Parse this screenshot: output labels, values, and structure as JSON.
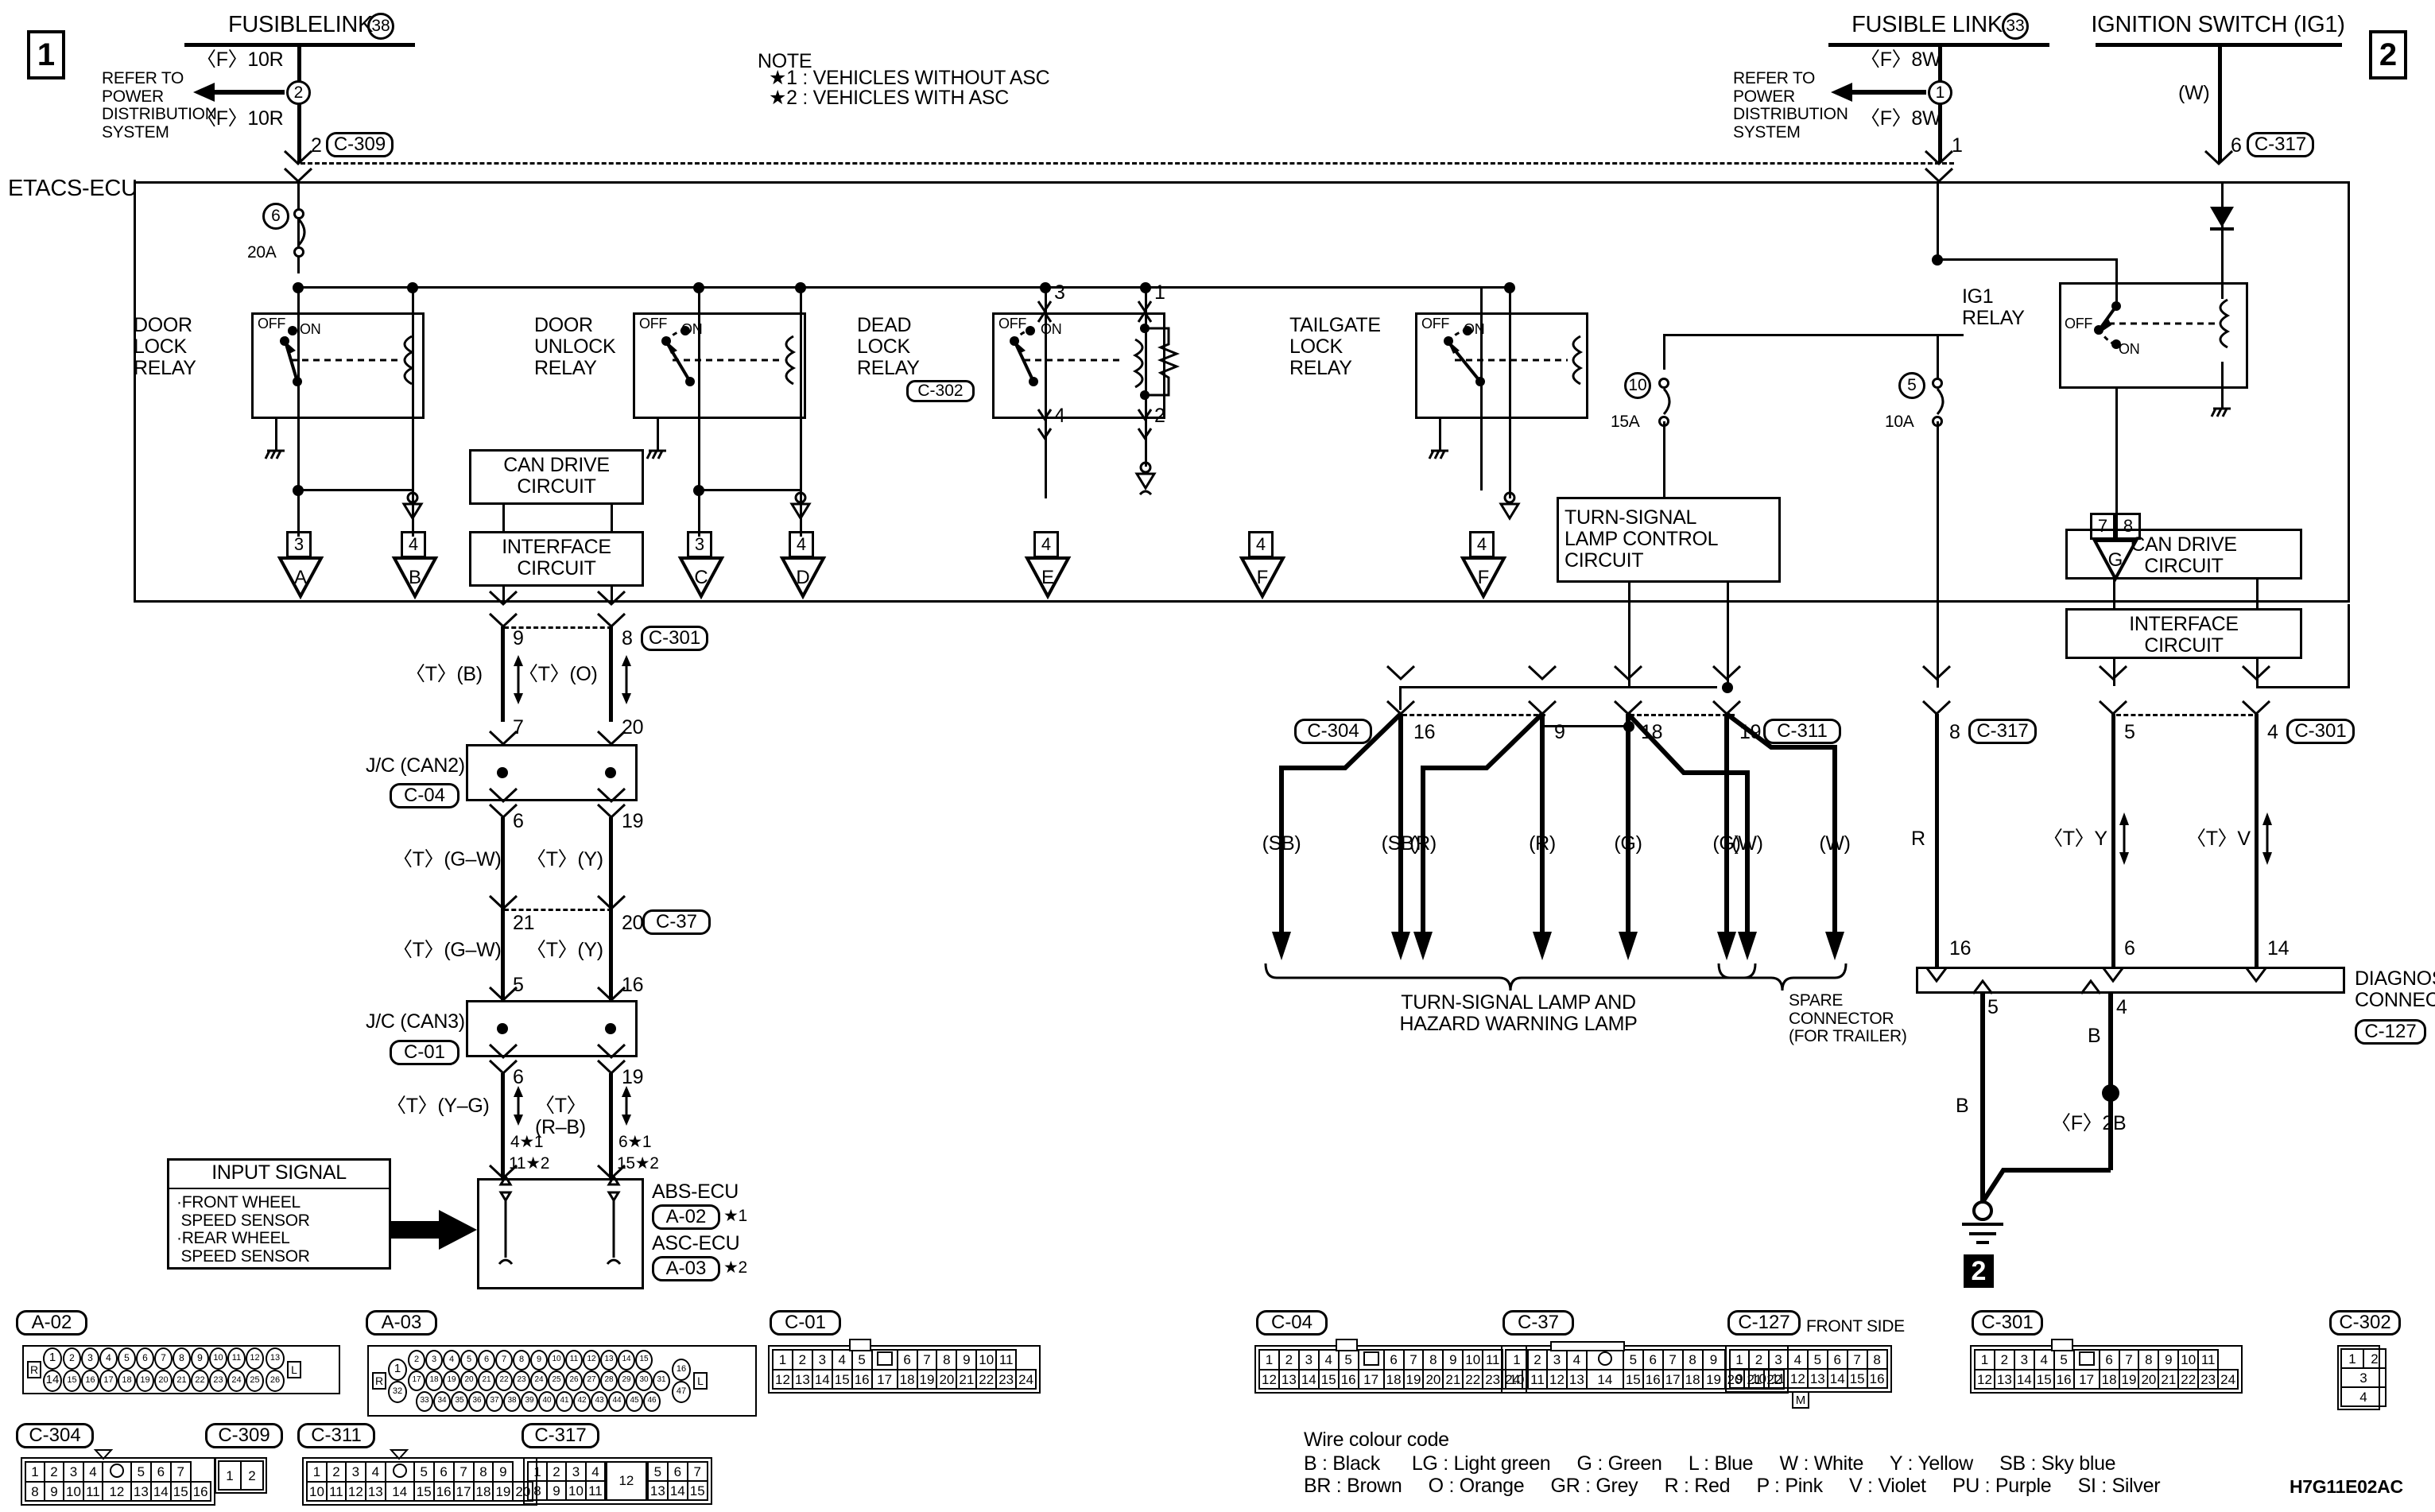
{
  "diagram": {
    "code": "H7G11E02AC",
    "page_left": "1",
    "page_right": "2",
    "page_ground_ref": "2"
  },
  "note": {
    "title": "NOTE",
    "lines": [
      "★1 : VEHICLES WITHOUT ASC",
      "★2 : VEHICLES WITH ASC"
    ]
  },
  "sources": {
    "fusible_link_38": {
      "title": "FUSIBLELINK",
      "circle": "38",
      "wire_top": "〈F〉10R",
      "wire_bottom": "〈F〉10R",
      "splice": "2",
      "pin": "2",
      "connector": "C-309"
    },
    "fusible_link_33": {
      "title": "FUSIBLE LINK",
      "circle": "33",
      "wire_top": "〈F〉8W",
      "wire_bottom": "〈F〉8W",
      "splice": "1",
      "pin": "1"
    },
    "ignition_switch": {
      "title": "IGNITION SWITCH (IG1)",
      "wire": "(W)",
      "pin": "6",
      "connector": "C-317"
    },
    "refer_note": "REFER TO\nPOWER\nDISTRIBUTION\nSYSTEM"
  },
  "ecu": {
    "label": "ETACS-ECU"
  },
  "fuses": [
    {
      "no": "6",
      "rating": "20A"
    },
    {
      "no": "10",
      "rating": "15A"
    },
    {
      "no": "5",
      "rating": "10A"
    }
  ],
  "relays": [
    {
      "name": "DOOR\nLOCK\nRELAY",
      "off": "OFF",
      "on": "ON"
    },
    {
      "name": "DOOR\nUNLOCK\nRELAY",
      "off": "OFF",
      "on": "ON"
    },
    {
      "name": "DEAD\nLOCK\nRELAY",
      "off": "OFF",
      "on": "ON",
      "connector": "C-302",
      "pins": [
        "3",
        "1",
        "4",
        "2"
      ]
    },
    {
      "name": "TAILGATE\nLOCK\nRELAY",
      "off": "OFF",
      "on": "ON"
    },
    {
      "name": "IG1\nRELAY",
      "off": "OFF",
      "on": "ON"
    }
  ],
  "blocks": {
    "can_drive_left": "CAN DRIVE\nCIRCUIT",
    "interface_left": "INTERFACE\nCIRCUIT",
    "turn_signal": "TURN-SIGNAL\nLAMP CONTROL\nCIRCUIT",
    "can_drive_right": "CAN DRIVE\nCIRCUIT",
    "interface_right": "INTERFACE\nCIRCUIT",
    "input_signal_title": "INPUT SIGNAL",
    "input_signal_items": "·FRONT WHEEL\n SPEED SENSOR\n·REAR WHEEL\n SPEED SENSOR"
  },
  "grounds": [
    {
      "num": "3",
      "letter": "A"
    },
    {
      "num": "4",
      "letter": "B"
    },
    {
      "num": "3",
      "letter": "C"
    },
    {
      "num": "4",
      "letter": "D"
    },
    {
      "num": "4",
      "letter": "E"
    },
    {
      "num": "4",
      "letter": "F"
    },
    {
      "num": "4",
      "letter": "F"
    },
    {
      "num": "7",
      "num2": "8",
      "letter": "G"
    }
  ],
  "can_bus": {
    "etacs_pins": [
      "9",
      "8"
    ],
    "etacs_connector": "C-301",
    "wires_1": [
      "〈T〉(B)",
      "〈T〉(O)"
    ],
    "jc_can2": {
      "label": "J/C (CAN2)",
      "connector": "C-04",
      "pins_top": [
        "7",
        "20"
      ],
      "pins_bot": [
        "6",
        "19"
      ]
    },
    "wires_2": [
      "〈T〉(G–W)",
      "〈T〉(Y)"
    ],
    "c37": {
      "connector": "C-37",
      "pins": [
        "21",
        "20"
      ]
    },
    "wires_3": [
      "〈T〉(G–W)",
      "〈T〉(Y)"
    ],
    "jc_can3": {
      "label": "J/C (CAN3)",
      "connector": "C-01",
      "pins_top": [
        "5",
        "16"
      ],
      "pins_bot": [
        "6",
        "19"
      ]
    },
    "wires_4": [
      "〈T〉(Y–G)",
      "〈T〉\n(R–B)"
    ],
    "abs_pins_left": [
      "4★1",
      "11★2"
    ],
    "abs_pins_right": [
      "6★1",
      "15★2"
    ],
    "abs_ecu": {
      "name1": "ABS-ECU",
      "conn1": "A-02",
      "star1": "★1",
      "name2": "ASC-ECU",
      "conn2": "A-03",
      "star2": "★2"
    }
  },
  "lamp_section": {
    "connectors": [
      {
        "name": "C-304",
        "pin": "16",
        "color": "(SB)"
      },
      {
        "pin": "",
        "color": "(SB)"
      },
      {
        "pin": "9",
        "color": "(R)"
      },
      {
        "pin": "",
        "color": "(R)"
      },
      {
        "pin": "18",
        "color": "(G)"
      },
      {
        "pin": "",
        "color": "(W)"
      },
      {
        "name": "C-311",
        "pin": "19",
        "color": "(G)"
      },
      {
        "pin": "",
        "color": "(W)"
      }
    ],
    "pins_row": [
      "16",
      "9",
      "18",
      "19"
    ],
    "label_main": "TURN-SIGNAL LAMP AND\nHAZARD WARNING LAMP",
    "label_spare": "SPARE\nCONNECTOR\n(FOR TRAILER)"
  },
  "diagnosis": {
    "title": "DIAGNOSIS\nCONNECTOR",
    "connector": "C-127",
    "top_pins": [
      {
        "pin": "8",
        "conn": "C-317",
        "wire": "R"
      },
      {
        "pin": "5",
        "conn": "",
        "wire": "〈T〉Y"
      },
      {
        "pin": "4",
        "conn": "C-301",
        "wire": "〈T〉V"
      }
    ],
    "bottom_pins": [
      "16",
      "6",
      "14"
    ],
    "out_pins": [
      "5",
      "4"
    ],
    "out_wires": [
      "B",
      "B"
    ],
    "fusible": "〈F〉2B"
  },
  "connector_tables": {
    "A-02": {
      "label": "A-02",
      "type": "oval",
      "left": "R",
      "right": "L",
      "first_col": [
        "1",
        "14"
      ],
      "row1": [
        "2",
        "3",
        "4",
        "5",
        "6",
        "7",
        "8",
        "9",
        "10",
        "11",
        "12"
      ],
      "row2": [
        "15",
        "16",
        "17",
        "18",
        "19",
        "20",
        "21",
        "22",
        "23",
        "24",
        "25"
      ],
      "last_col": [
        "13",
        "26"
      ]
    },
    "A-03": {
      "label": "A-03",
      "type": "oval",
      "left": "R",
      "right": "L",
      "first_col": [
        "1",
        "32"
      ],
      "row1": [
        "2",
        "3",
        "4",
        "5",
        "6",
        "7",
        "8",
        "9",
        "10",
        "11",
        "12",
        "13",
        "14",
        "15"
      ],
      "row2": [
        "17",
        "18",
        "19",
        "20",
        "21",
        "22",
        "23",
        "24",
        "25",
        "26",
        "27",
        "28",
        "29",
        "30",
        "31"
      ],
      "row3": [
        "33",
        "34",
        "35",
        "36",
        "37",
        "38",
        "39",
        "40",
        "41",
        "42",
        "43",
        "44",
        "45",
        "46"
      ],
      "last_col": [
        "16",
        "47"
      ]
    },
    "C-01": {
      "label": "C-01",
      "row1": [
        "1",
        "2",
        "3",
        "4",
        "5",
        "",
        "6",
        "7",
        "8",
        "9",
        "10",
        "11"
      ],
      "row2": [
        "12",
        "13",
        "14",
        "15",
        "16",
        "17",
        "18",
        "19",
        "20",
        "21",
        "22",
        "23",
        "24"
      ]
    },
    "C-04": {
      "label": "C-04",
      "row1": [
        "1",
        "2",
        "3",
        "4",
        "5",
        "",
        "6",
        "7",
        "8",
        "9",
        "10",
        "11"
      ],
      "row2": [
        "12",
        "13",
        "14",
        "15",
        "16",
        "17",
        "18",
        "19",
        "20",
        "21",
        "22",
        "23",
        "24"
      ]
    },
    "C-37": {
      "label": "C-37",
      "row1": [
        "1",
        "2",
        "3",
        "4",
        "",
        "",
        "5",
        "6",
        "7",
        "8",
        "9"
      ],
      "row2": [
        "10",
        "11",
        "12",
        "13",
        "14",
        "15",
        "16",
        "17",
        "18",
        "19",
        "20",
        "21",
        "22"
      ]
    },
    "C-127": {
      "label": "C-127",
      "side_note": "FRONT SIDE",
      "bottom_tab": "M",
      "row1": [
        "1",
        "2",
        "3",
        "4",
        "5",
        "6",
        "7",
        "8"
      ],
      "row2": [
        "9",
        "10",
        "11",
        "12",
        "13",
        "14",
        "15",
        "16"
      ]
    },
    "C-301": {
      "label": "C-301",
      "row1": [
        "1",
        "2",
        "3",
        "4",
        "5",
        "",
        "6",
        "7",
        "8",
        "9",
        "10",
        "11"
      ],
      "row2": [
        "12",
        "13",
        "14",
        "15",
        "16",
        "17",
        "18",
        "19",
        "20",
        "21",
        "22",
        "23",
        "24"
      ]
    },
    "C-302": {
      "label": "C-302",
      "cells": [
        "1",
        "2",
        "3",
        "4"
      ]
    },
    "C-304": {
      "label": "C-304",
      "row1": [
        "1",
        "2",
        "3",
        "4",
        "",
        "5",
        "6",
        "7"
      ],
      "row2": [
        "8",
        "9",
        "10",
        "11",
        "12",
        "13",
        "14",
        "15",
        "16"
      ]
    },
    "C-309": {
      "label": "C-309",
      "cells": [
        "1",
        "2"
      ]
    },
    "C-311": {
      "label": "C-311",
      "row1": [
        "1",
        "2",
        "3",
        "4",
        "",
        "5",
        "6",
        "7",
        "8",
        "9"
      ],
      "row2": [
        "10",
        "11",
        "12",
        "13",
        "14",
        "15",
        "16",
        "17",
        "18",
        "19",
        "20"
      ]
    },
    "C-317": {
      "label": "C-317",
      "row1": [
        "1",
        "2",
        "3",
        "4"
      ],
      "row1b": [
        "5",
        "6",
        "7"
      ],
      "row2": [
        "8",
        "9",
        "10",
        "11"
      ],
      "row2b": [
        "13",
        "14",
        "15"
      ],
      "mid": "12"
    }
  },
  "wire_colour_code": {
    "title": "Wire colour code",
    "line1": "B : Black      LG : Light green     G : Green     L : Blue     W : White     Y : Yellow     SB : Sky blue",
    "line2": "BR : Brown     O : Orange     GR : Grey     R : Red     P : Pink     V : Violet     PU : Purple     SI : Silver"
  }
}
